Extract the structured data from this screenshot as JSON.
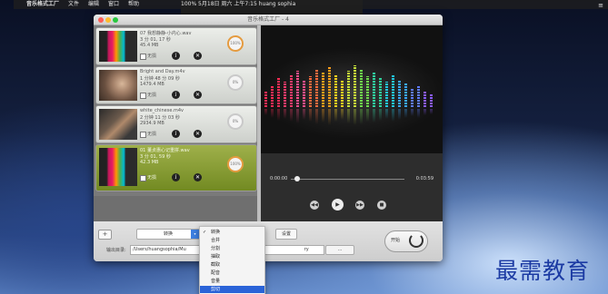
{
  "menubar": {
    "app": "音乐格式工厂",
    "items": [
      "文件",
      "编辑",
      "窗口",
      "帮助"
    ],
    "status_right": "100% 5月18日 周六 上午7:15 huang sophia"
  },
  "window": {
    "title": "音乐格式工厂 - 4"
  },
  "files": [
    {
      "name": "07 我想静静-小内心.wav",
      "duration": "3 分 01, 17 秒",
      "size": "45.4 MB",
      "checkbox_label": "无损",
      "progress": "100%",
      "done": true
    },
    {
      "name": "Bright and Day.m4v",
      "duration": "1 分钟 48 分 09 秒",
      "size": "1479.4 MB",
      "checkbox_label": "无损",
      "progress": "0%",
      "done": false
    },
    {
      "name": "white_chinese.m4v",
      "duration": "2 分钟 11 分 03 秒",
      "size": "2934.9 MB",
      "checkbox_label": "无损",
      "progress": "0%",
      "done": false
    },
    {
      "name": "01 董贞惠心记重拼.wav",
      "duration": "3 分 01, 59 秒",
      "size": "42.3 MB",
      "checkbox_label": "无损",
      "progress": "100%",
      "done": true
    }
  ],
  "player": {
    "current_time": "0:00:00",
    "end_time": "0:03:59",
    "controls": [
      "rewind",
      "play",
      "forward",
      "stop"
    ]
  },
  "bottom": {
    "add_label": "+",
    "format_selected": "转换",
    "settings_label": "设置",
    "output_label": "输出目录:",
    "output_path": "/Users/huangsophia/Mu",
    "output_path_tail": "ry",
    "browse_label": "...",
    "start_label": "开始"
  },
  "dropdown": {
    "items": [
      "转换",
      "合并",
      "分割",
      "抽取",
      "截取",
      "配音",
      "音量",
      "剪切"
    ],
    "checked_index": 0,
    "highlight_index": 7
  },
  "watermark": "最需教育",
  "colors": {
    "selected_item": "#8aa038",
    "accent": "#2a63d8",
    "progress_done": "#e59b3f"
  }
}
